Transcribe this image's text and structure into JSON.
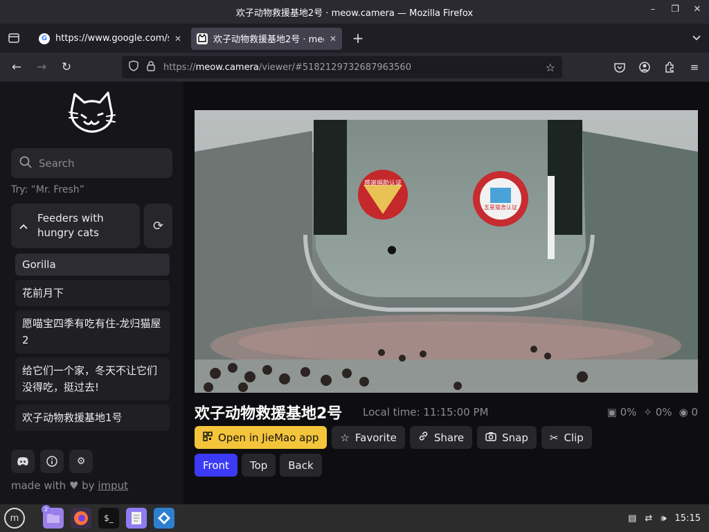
{
  "window": {
    "title": "欢子动物救援基地2号 · meow.camera — Mozilla Firefox",
    "controls": [
      "–",
      "❐",
      "✕"
    ]
  },
  "tabs": [
    {
      "title": "https://www.google.com/se"
    },
    {
      "title": "欢子动物救援基地2号 · meow.c"
    }
  ],
  "newtab": "+",
  "urlbar": {
    "scheme": "https://",
    "host": "meow.camera",
    "rest": "/viewer/#5182129732687963560"
  },
  "sidebar": {
    "search_placeholder": "Search",
    "hint": "Try: “Mr. Fresh”",
    "feeders_label": "Feeders with hungry cats",
    "cameras": [
      "Gorilla",
      "花前月下",
      "愿喵宝四季有吃有住-龙归猫屋2",
      "给它们一个家，冬天不让它们没得吃，挺过去!",
      "欢子动物救援基地1号"
    ],
    "made_with": "made with",
    "by": "by",
    "author": "imput"
  },
  "camera": {
    "title": "欢子动物救援基地2号",
    "local_time": "Local time: 11:15:00 PM",
    "stat1": "0%",
    "stat2": "0%",
    "viewers": "0",
    "sticker1": "感谢捐助认证",
    "sticker2": "五星猫舍认证"
  },
  "actions": {
    "open_app": "Open in JieMao app",
    "favorite": "Favorite",
    "share": "Share",
    "snap": "Snap",
    "clip": "Clip"
  },
  "views": [
    "Front",
    "Top",
    "Back"
  ],
  "taskbar": {
    "badge": "2",
    "clock": "15:15"
  }
}
